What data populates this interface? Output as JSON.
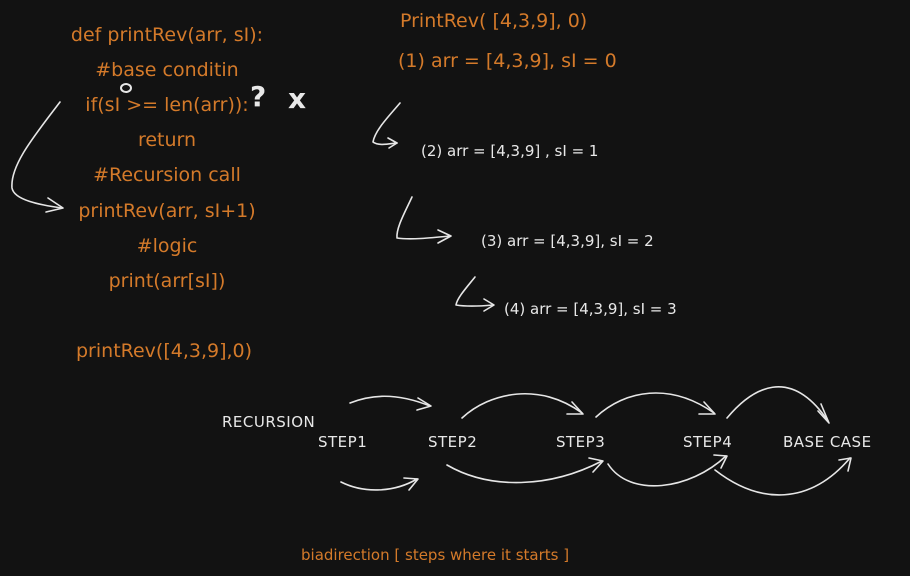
{
  "code": {
    "lines": [
      "def printRev(arr, sI):",
      "#base conditin",
      "if(sI >= len(arr)):",
      "return",
      "#Recursion call",
      "printRev(arr, sI+1)",
      "#logic",
      "print(arr[sI])"
    ],
    "call": "printRev([4,3,9],0)",
    "scribble_mark": "?",
    "scribble_x": "x"
  },
  "trace": {
    "title": "PrintRev( [4,3,9], 0)",
    "step1": "(1) arr = [4,3,9], sI = 0",
    "step2": "(2) arr = [4,3,9] , sI = 1",
    "step3": "(3) arr = [4,3,9], sI = 2",
    "step4": "(4) arr = [4,3,9], sI = 3"
  },
  "flow": {
    "label": "RECURSION",
    "steps": [
      "STEP1",
      "STEP2",
      "STEP3",
      "STEP4",
      "BASE CASE"
    ],
    "caption": "biadirection [ steps where it starts ]"
  },
  "colors": {
    "background": "#121212",
    "code": "#d47a2a",
    "annotation": "#e8e8e8"
  }
}
